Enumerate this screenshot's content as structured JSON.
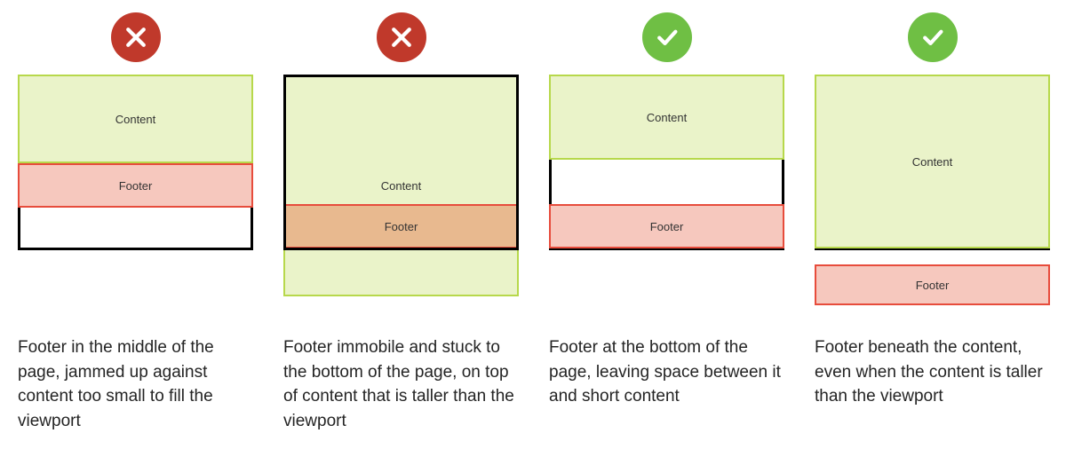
{
  "labels": {
    "content": "Content",
    "footer": "Footer"
  },
  "diagrams": [
    {
      "status": "bad",
      "caption": "Footer in the middle of the page, jammed up against content too small to fill the viewport"
    },
    {
      "status": "bad",
      "caption": "Footer immobile and stuck to the bottom of the page, on top of content that is taller than the viewport"
    },
    {
      "status": "good",
      "caption": "Footer at the bottom of the page, leaving space between it and short content"
    },
    {
      "status": "good",
      "caption": "Footer beneath the content, even when the content is taller than the viewport"
    }
  ]
}
